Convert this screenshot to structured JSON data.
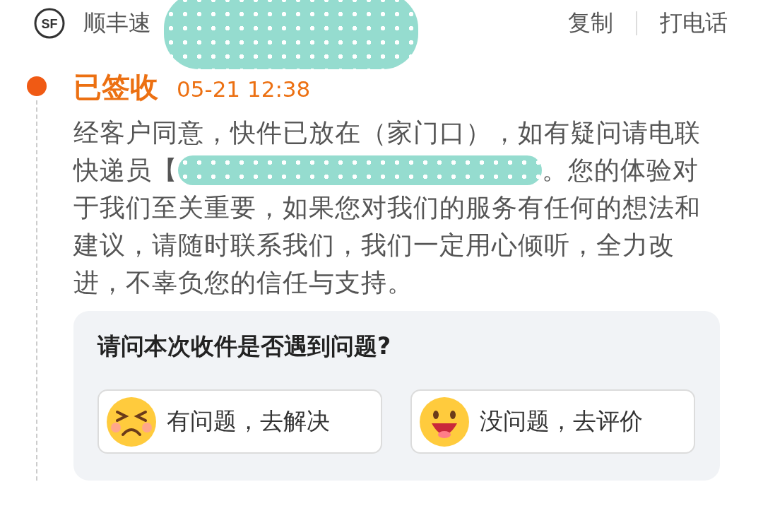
{
  "header": {
    "logo": "SF",
    "carrier": "顺丰速",
    "redacted": true,
    "actions": [
      "复制",
      "打电话"
    ]
  },
  "event": {
    "status": "已签收",
    "time": "05-21 12:38",
    "message_line_1": "经客户同意，快件已放在（家门口），如有疑问请电联",
    "message_before_redaction": "快递员【",
    "redacted": true,
    "message_after_redaction": "。您的体验对",
    "message_rest": "于我们至关重要，如果您对我们的服务有任何的想法和建议，请随时联系我们，我们一定用心倾听，全力改进，不辜负您的信任与支持。"
  },
  "survey": {
    "question": "请问本次收件是否遇到问题?",
    "options": [
      {
        "label": "有问题，去解决",
        "kind": "unhappy"
      },
      {
        "label": "没问题，去评价",
        "kind": "happy"
      }
    ]
  }
}
